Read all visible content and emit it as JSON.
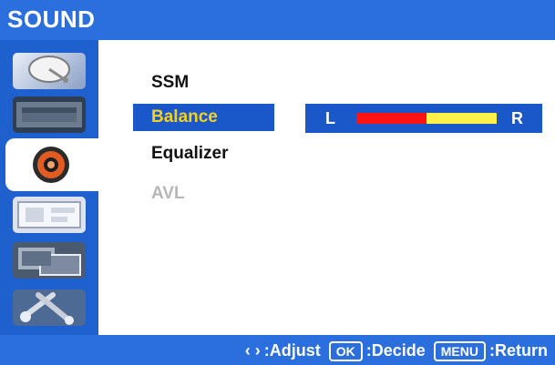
{
  "header": {
    "title": "SOUND"
  },
  "sidebar": {
    "items": [
      {
        "name": "picture",
        "icon": "satellite-dish-icon",
        "selected": false
      },
      {
        "name": "screen",
        "icon": "tv-image-icon",
        "selected": false
      },
      {
        "name": "sound",
        "icon": "speaker-icon",
        "selected": true
      },
      {
        "name": "setup",
        "icon": "settings-panel-icon",
        "selected": false
      },
      {
        "name": "features",
        "icon": "multi-screen-icon",
        "selected": false
      },
      {
        "name": "tools",
        "icon": "tools-icon",
        "selected": false
      }
    ]
  },
  "menu": {
    "items": [
      {
        "label": "SSM",
        "state": "normal"
      },
      {
        "label": "Balance",
        "state": "selected"
      },
      {
        "label": "Equalizer",
        "state": "normal"
      },
      {
        "label": "AVL",
        "state": "disabled"
      }
    ]
  },
  "balance": {
    "left_label": "L",
    "right_label": "R",
    "position": 0.5,
    "left_color": "#ff1212",
    "right_color": "#fff04a"
  },
  "footer": {
    "adjust": ":Adjust",
    "ok_key": "OK",
    "decide": ":Decide",
    "menu_key": "MENU",
    "return": ":Return"
  },
  "colors": {
    "bar_blue": "#2b6fde",
    "selected_blue": "#1a57c8",
    "selected_text": "#f6d01f"
  }
}
